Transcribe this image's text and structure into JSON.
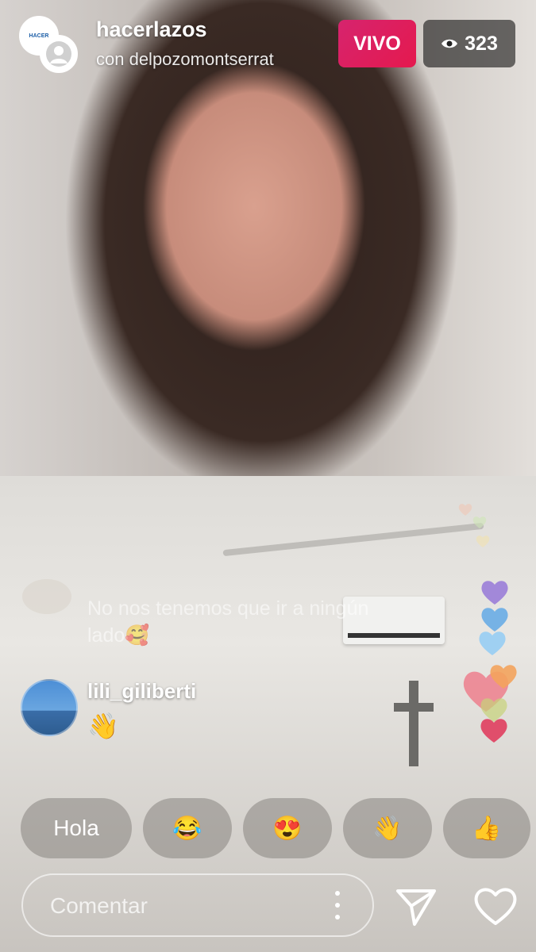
{
  "header": {
    "username": "hacerlazos",
    "cohost_line": "con delpozomontserrat",
    "avatar_text": "HACER",
    "live_label": "VIVO",
    "viewer_count": "323"
  },
  "comments": [
    {
      "user": "",
      "text": "No nos tenemos que ir a ningún lado🥰",
      "faded": true
    },
    {
      "user": "lili_giliberti",
      "text": "👋",
      "faded": false
    }
  ],
  "quick_replies": [
    "Hola",
    "😂",
    "😍",
    "👋",
    "👍"
  ],
  "comment_box": {
    "placeholder": "Comentar"
  },
  "colors": {
    "live_badge": "#e0195a",
    "hearts": [
      "#f3c4b0",
      "#cfe6b8",
      "#f5e2a8",
      "#9b7fd9",
      "#5aa6e6",
      "#9fd0f2",
      "#f06b7d",
      "#f4a45e",
      "#c7d37a",
      "#e04e6b"
    ]
  },
  "icons": {
    "eye": "eye-icon",
    "send": "send-icon",
    "like": "heart-icon",
    "more": "more-vertical-icon"
  }
}
